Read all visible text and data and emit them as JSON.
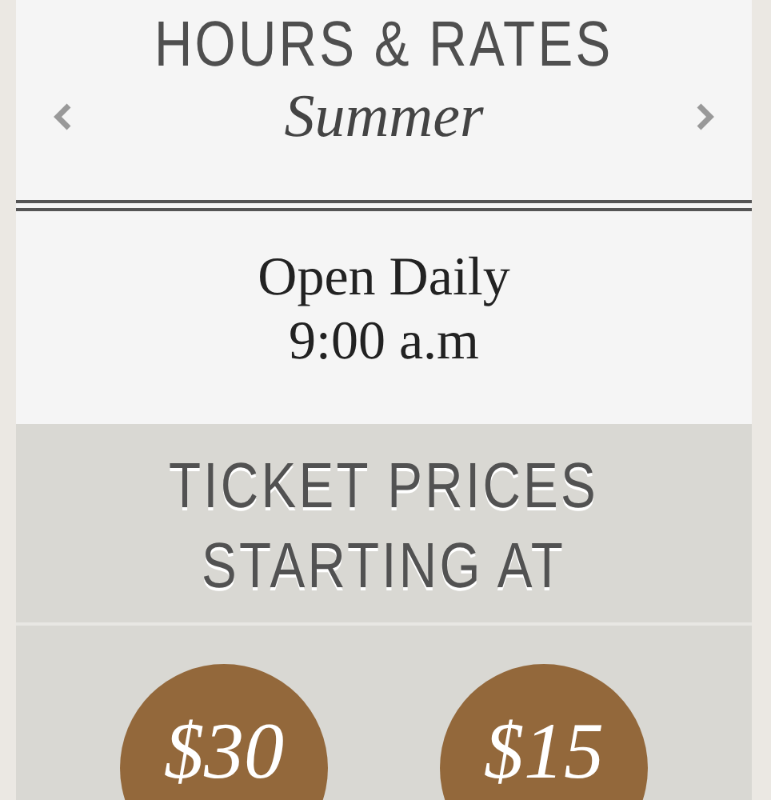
{
  "title": "HOURS & RATES",
  "season": {
    "label": "Summer"
  },
  "hours": [
    "Open Daily",
    "9:00 a.m"
  ],
  "tickets": {
    "heading": [
      "TICKET PRICES",
      "STARTING AT"
    ],
    "prices": [
      {
        "amount": "$30"
      },
      {
        "amount": "$15"
      }
    ]
  }
}
